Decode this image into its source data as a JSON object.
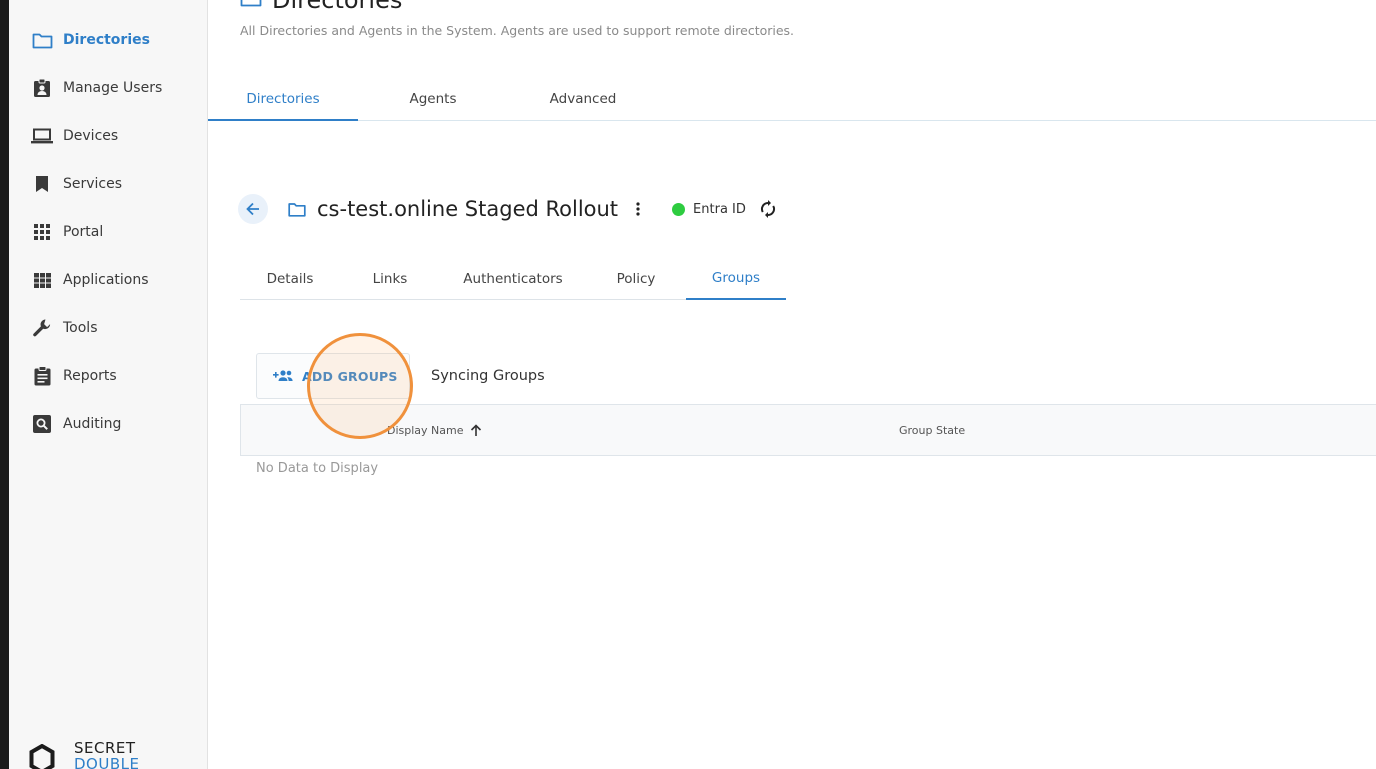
{
  "sidebar": {
    "items": [
      {
        "label": "Directories",
        "icon": "folder-icon",
        "active": true
      },
      {
        "label": "Manage Users",
        "icon": "badge-icon",
        "active": false
      },
      {
        "label": "Devices",
        "icon": "laptop-icon",
        "active": false
      },
      {
        "label": "Services",
        "icon": "bookmark-icon",
        "active": false
      },
      {
        "label": "Portal",
        "icon": "grid-icon",
        "active": false
      },
      {
        "label": "Applications",
        "icon": "apps-icon",
        "active": false
      },
      {
        "label": "Tools",
        "icon": "wrench-icon",
        "active": false
      },
      {
        "label": "Reports",
        "icon": "clipboard-icon",
        "active": false
      },
      {
        "label": "Auditing",
        "icon": "search-box-icon",
        "active": false
      }
    ],
    "brand": {
      "line1": "SECRET",
      "line2": "DOUBLE"
    }
  },
  "page": {
    "title": "Directories",
    "subtitle": "All Directories and Agents in the System. Agents are used to support remote directories."
  },
  "top_tabs": [
    {
      "label": "Directories",
      "active": true
    },
    {
      "label": "Agents",
      "active": false
    },
    {
      "label": "Advanced",
      "active": false
    }
  ],
  "directory": {
    "name": "cs-test.online Staged Rollout",
    "status_label": "Entra ID",
    "status_color": "#2ecc40"
  },
  "sub_tabs": [
    {
      "label": "Details",
      "active": false
    },
    {
      "label": "Links",
      "active": false
    },
    {
      "label": "Authenticators",
      "active": false
    },
    {
      "label": "Policy",
      "active": false
    },
    {
      "label": "Groups",
      "active": true
    }
  ],
  "groups": {
    "add_button_label": "ADD GROUPS",
    "section_title": "Syncing Groups",
    "columns": [
      "Display Name",
      "Group State"
    ],
    "empty_text": "No Data to Display"
  },
  "colors": {
    "accent": "#2f7fc8",
    "highlight": "#f0913c"
  }
}
